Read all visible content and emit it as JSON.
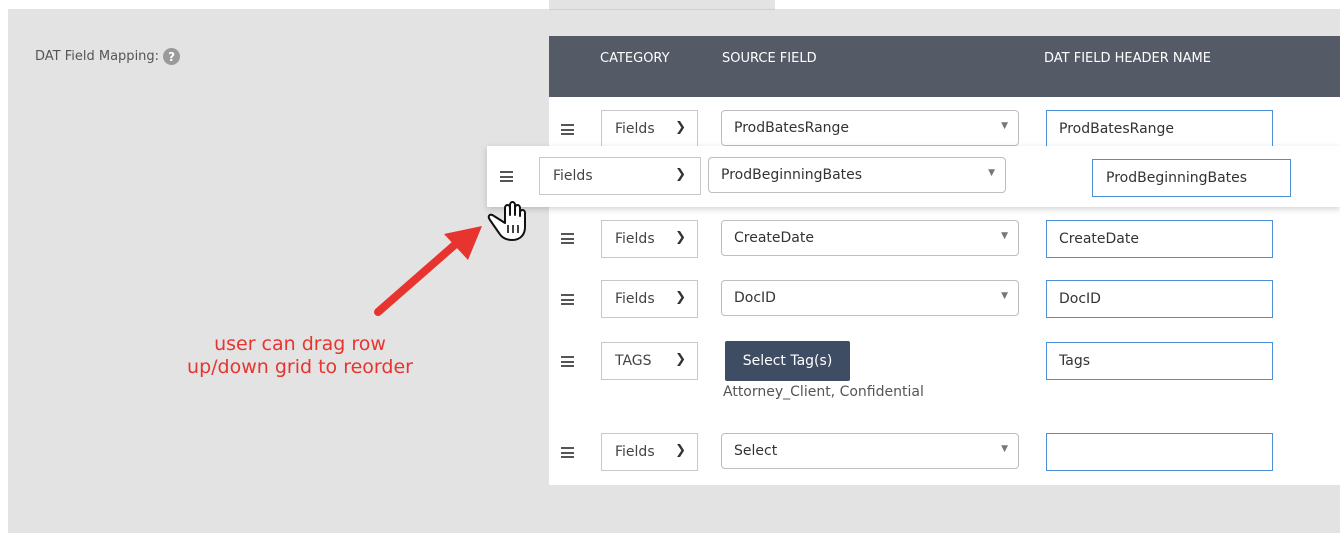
{
  "section_label": "DAT Field Mapping:",
  "help_glyph": "?",
  "columns": {
    "category": "CATEGORY",
    "source_field": "SOURCE FIELD",
    "dat_header": "DAT FIELD HEADER NAME"
  },
  "rows": [
    {
      "category": "Fields",
      "source": "ProdBatesRange",
      "header": "ProdBatesRange"
    },
    {
      "category": "Fields",
      "source": "ProdBeginningBates",
      "header": "ProdBeginningBates",
      "dragging": true
    },
    {
      "category": "Fields",
      "source": "CreateDate",
      "header": "CreateDate"
    },
    {
      "category": "Fields",
      "source": "DocID",
      "header": "DocID"
    },
    {
      "category": "TAGS",
      "button": "Select Tag(s)",
      "tags": "Attorney_Client, Confidential",
      "header": "Tags"
    },
    {
      "category": "Fields",
      "source": "Select",
      "header": ""
    }
  ],
  "annotation": {
    "line1": "user can drag row",
    "line2": "up/down grid to reorder",
    "color": "#e8342f"
  },
  "colors": {
    "header_bg": "#545b67",
    "button_bg": "#3e4d63",
    "input_border": "#4a90d9"
  }
}
